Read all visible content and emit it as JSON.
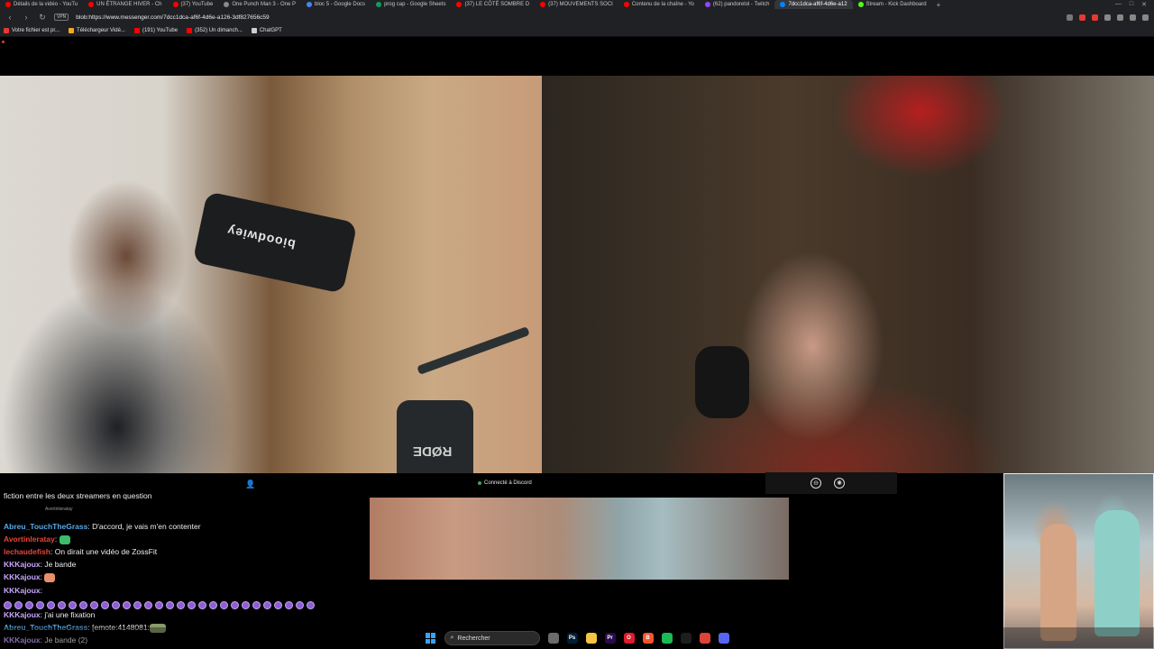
{
  "browser": {
    "tabs": [
      {
        "label": "Détails de la vidéo - YouTu",
        "color": "#ff0000",
        "active": false
      },
      {
        "label": "UN ÉTRANGE HIVER - Ch",
        "color": "#ff0000",
        "active": false
      },
      {
        "label": "(37) YouTube",
        "color": "#ff0000",
        "active": false
      },
      {
        "label": "One Punch Man 3 - One P",
        "color": "#8a8a8a",
        "active": false
      },
      {
        "label": "bloc 5 - Google Docs",
        "color": "#4285f4",
        "active": false
      },
      {
        "label": "prog cap - Google Sheets",
        "color": "#0f9d58",
        "active": false
      },
      {
        "label": "(37) LE CÔTÉ SOMBRE D",
        "color": "#ff0000",
        "active": false
      },
      {
        "label": "(37) MOUVEMENTS SOCI",
        "color": "#ff0000",
        "active": false
      },
      {
        "label": "Contenu de la chaîne - Yo",
        "color": "#ff0000",
        "active": false
      },
      {
        "label": "(62) pandorelol - Twitch",
        "color": "#9146ff",
        "active": false
      },
      {
        "label": "7dcc1dca-af6f-4d6e-a12",
        "color": "#0084ff",
        "active": true
      },
      {
        "label": "Stream - Kick Dashboard",
        "color": "#53fc18",
        "active": false
      }
    ],
    "new_tab_label": "+",
    "url": "blob:https://www.messenger.com/7dcc1dca-af6f-4d6e-a126-3df827656c59",
    "vpn_label": "VPN",
    "bookmarks": [
      {
        "label": "Votre fichier est pr...",
        "color": "#e53935"
      },
      {
        "label": "Téléchargeur Vidé...",
        "color": "#f9a825"
      },
      {
        "label": "(191) YouTube",
        "color": "#ff0000"
      },
      {
        "label": "(352) Un dimanch...",
        "color": "#ff0000"
      },
      {
        "label": "ChatGPT",
        "color": "#cfcfcf"
      }
    ]
  },
  "call": {
    "status": "Connecté à Discord",
    "bottle_text": "bioodwiey",
    "mic_text": "RØDE"
  },
  "chat": {
    "lines": [
      {
        "user": "",
        "text": "fiction entre les deux streamers en question",
        "user_color": "#ffffff"
      },
      {
        "user": "Abreu_TouchTheGrass",
        "text": "D'accord, je vais m'en contenter",
        "user_color": "#5aa9e6"
      },
      {
        "user": "Avortinleratay",
        "text": "",
        "user_color": "#e8453c"
      },
      {
        "user": "lechaudefish",
        "text": "On dirait une vidéo de ZossFit",
        "user_color": "#e8453c"
      },
      {
        "user": "KKKajoux",
        "text": "Je bande",
        "user_color": "#c9a7ff"
      },
      {
        "user": "KKKajoux",
        "text": "",
        "user_color": "#c9a7ff"
      },
      {
        "user": "KKKajoux",
        "text": "",
        "user_color": "#c9a7ff"
      },
      {
        "user": "KKKajoux",
        "text": "j'ai une fixation",
        "user_color": "#c9a7ff"
      },
      {
        "user": "Abreu_TouchTheGrass",
        "text": "[emote:4148081:",
        "user_color": "#5aa9e6"
      },
      {
        "user": "KKKajoux",
        "text": "Je bande (2)",
        "user_color": "#c9a7ff"
      }
    ],
    "faint_label": "Avortinleratay"
  },
  "taskbar": {
    "search_placeholder": "Rechercher",
    "apps": [
      {
        "name": "file-explorer",
        "label": "",
        "color": "#6b6b6b"
      },
      {
        "name": "photoshop",
        "label": "Ps",
        "color": "#001e36"
      },
      {
        "name": "folder",
        "label": "",
        "color": "#f4c542"
      },
      {
        "name": "premiere",
        "label": "Pr",
        "color": "#2a0a4d"
      },
      {
        "name": "opera",
        "label": "O",
        "color": "#e01b2c"
      },
      {
        "name": "brave",
        "label": "B",
        "color": "#fb542b"
      },
      {
        "name": "spotify",
        "label": "",
        "color": "#1db954"
      },
      {
        "name": "terminal",
        "label": "",
        "color": "#1e1e1e"
      },
      {
        "name": "chrome",
        "label": "",
        "color": "#db4437"
      },
      {
        "name": "discord",
        "label": "",
        "color": "#5865f2"
      }
    ]
  }
}
